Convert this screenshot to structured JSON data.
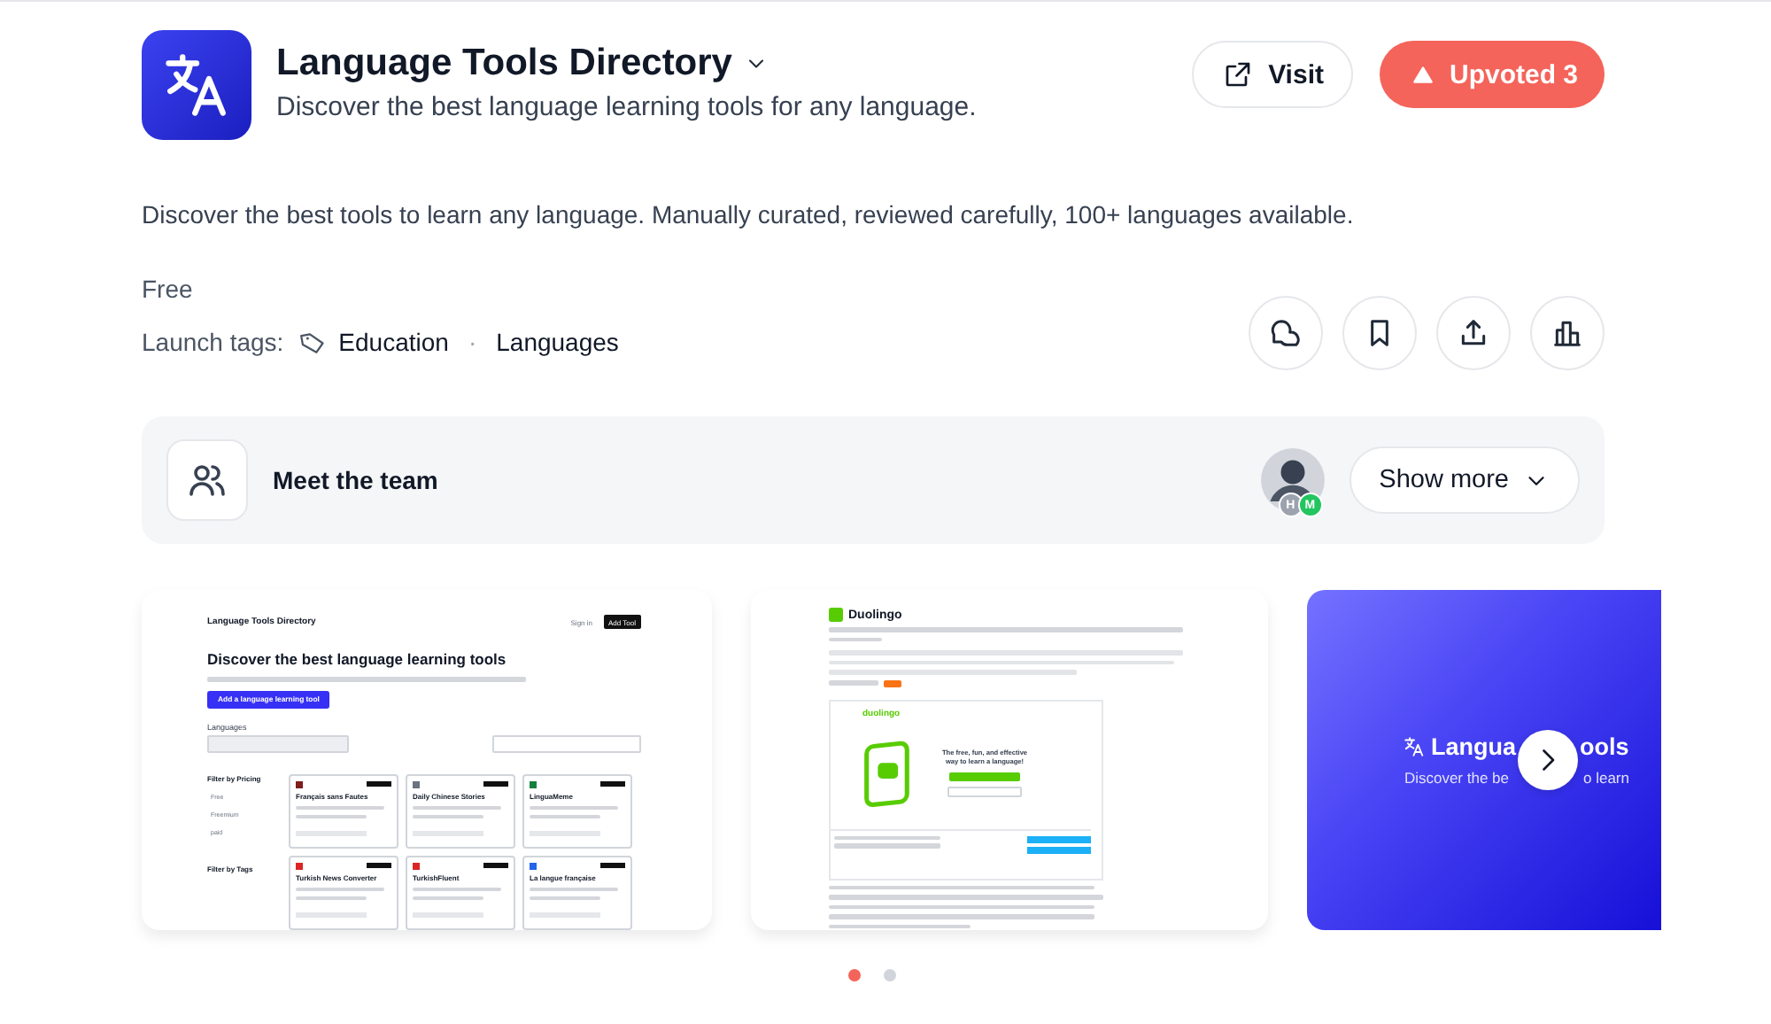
{
  "product": {
    "name": "Language Tools Directory",
    "tagline": "Discover the best language learning tools for any language."
  },
  "actions": [
    {
      "kind": "visit",
      "label": "Visit"
    },
    {
      "kind": "upvote",
      "label": "Upvoted 3",
      "selected": true
    }
  ],
  "description": "Discover the best tools to learn any language. Manually curated, reviewed carefully, 100+ languages available.",
  "pricing": "Free",
  "launch_tags": {
    "label": "Launch tags:",
    "tags": [
      "Education",
      "Languages"
    ],
    "separator": "·"
  },
  "team": {
    "title": "Meet the team",
    "member_badges": [
      {
        "initial": "H",
        "color": "#9ca3af"
      },
      {
        "initial": "M",
        "color": "#22c55e"
      }
    ],
    "button": "Show more"
  },
  "gallery": {
    "items": [
      {
        "kind": "directory",
        "site_title": "Language Tools Directory",
        "sign_in": "Sign in",
        "add_tool": "Add Tool",
        "heading": "Discover the best language learning tools",
        "cta": "Add a language learning tool",
        "languages_label": "Languages",
        "pricing_filter": "Filter by Pricing",
        "pricing_options": [
          "Free",
          "Freemium",
          "paid"
        ],
        "tags_filter": "Filter by Tags",
        "tools": [
          {
            "name": "Français sans Fautes",
            "color": "#7f1d1d"
          },
          {
            "name": "Daily Chinese Stories",
            "color": "#6b7280"
          },
          {
            "name": "LinguaMeme",
            "color": "#15803d"
          },
          {
            "name": "Turkish News Converter",
            "color": "#dc2626"
          },
          {
            "name": "TurkishFluent",
            "color": "#dc2626"
          },
          {
            "name": "La langue française",
            "color": "#2563eb"
          }
        ]
      },
      {
        "kind": "listing",
        "title": "Duolingo",
        "app_brand": "duolingo",
        "slogan": "The free, fun, and effective way to learn a language!"
      },
      {
        "kind": "banner",
        "title_parts": [
          "Langua",
          "ools"
        ],
        "subtitle_parts": [
          "Discover the be",
          "o learn"
        ]
      }
    ],
    "dots": [
      {
        "selected": true
      },
      {
        "selected": false
      }
    ]
  }
}
